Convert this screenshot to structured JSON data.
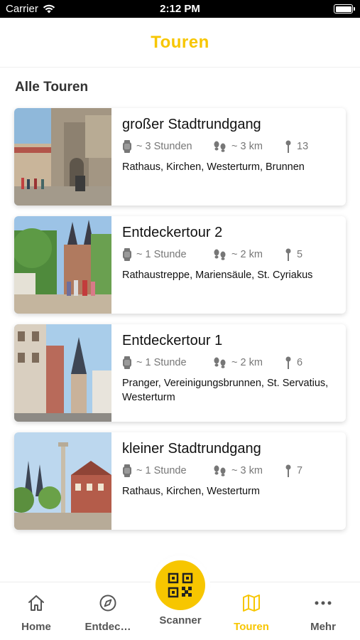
{
  "status_bar": {
    "carrier": "Carrier",
    "time": "2:12 PM"
  },
  "header": {
    "title": "Touren",
    "accent_color": "#f7c600"
  },
  "section": {
    "title": "Alle Touren"
  },
  "tours": [
    {
      "title": "großer Stadtrundgang",
      "duration": "~ 3 Stunden",
      "distance": "~ 3 km",
      "stops": "13",
      "description": "Rathaus, Kirchen, Westerturm, Brunnen"
    },
    {
      "title": "Entdeckertour 2",
      "duration": "~ 1 Stunde",
      "distance": "~ 2 km",
      "stops": "5",
      "description": "Rathaustreppe, Mariensäule, St. Cyriakus"
    },
    {
      "title": "Entdeckertour 1",
      "duration": "~ 1 Stunde",
      "distance": "~ 2 km",
      "stops": "6",
      "description": "Pranger, Vereinigungsbrunnen, St. Servatius, Westerturm"
    },
    {
      "title": "kleiner Stadtrundgang",
      "duration": "~ 1 Stunde",
      "distance": "~ 3 km",
      "stops": "7",
      "description": "Rathaus, Kirchen, Westerturm"
    }
  ],
  "tab_bar": {
    "items": [
      {
        "label": "Home",
        "icon": "home-icon"
      },
      {
        "label": "Entdec…",
        "icon": "compass-icon"
      },
      {
        "label": "Scanner",
        "icon": "qr-code-icon"
      },
      {
        "label": "Touren",
        "icon": "map-icon"
      },
      {
        "label": "Mehr",
        "icon": "more-dots-icon"
      }
    ],
    "active": "Touren"
  }
}
